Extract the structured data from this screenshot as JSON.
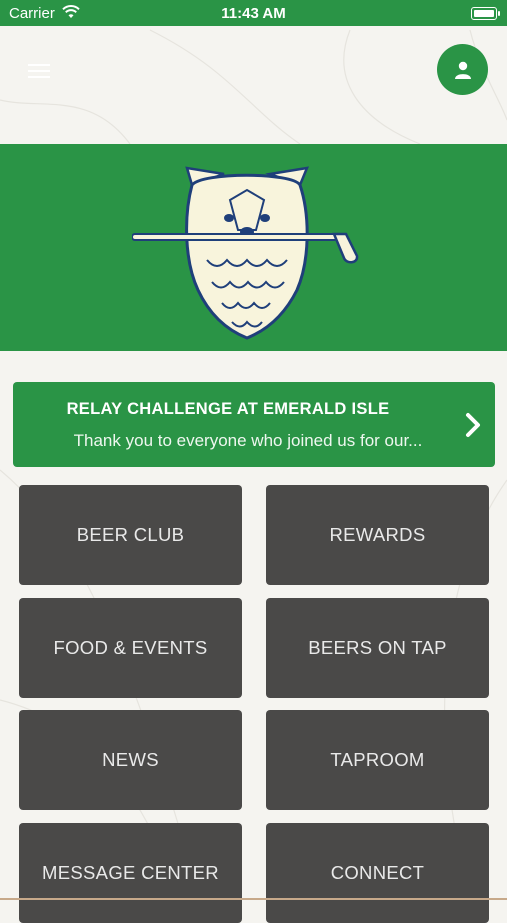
{
  "status_bar": {
    "carrier": "Carrier",
    "time": "11:43 AM"
  },
  "header": {
    "menu_icon": "hamburger-icon",
    "profile_icon": "user-icon"
  },
  "banner": {
    "logo": "dog-with-golf-club-logo",
    "color": "#2a9446"
  },
  "promo": {
    "title": "RELAY CHALLENGE AT EMERALD ISLE",
    "subtitle": "Thank you to everyone who joined us for our...",
    "icon": "chevron-right-icon"
  },
  "tiles": [
    {
      "label": "BEER CLUB"
    },
    {
      "label": "REWARDS"
    },
    {
      "label": "FOOD & EVENTS"
    },
    {
      "label": "BEERS ON TAP"
    },
    {
      "label": "NEWS"
    },
    {
      "label": "TAPROOM"
    },
    {
      "label": "MESSAGE CENTER"
    },
    {
      "label": "CONNECT"
    }
  ],
  "colors": {
    "accent": "#2a9446",
    "tile": "#4a4948",
    "background": "#f5f4f0"
  }
}
